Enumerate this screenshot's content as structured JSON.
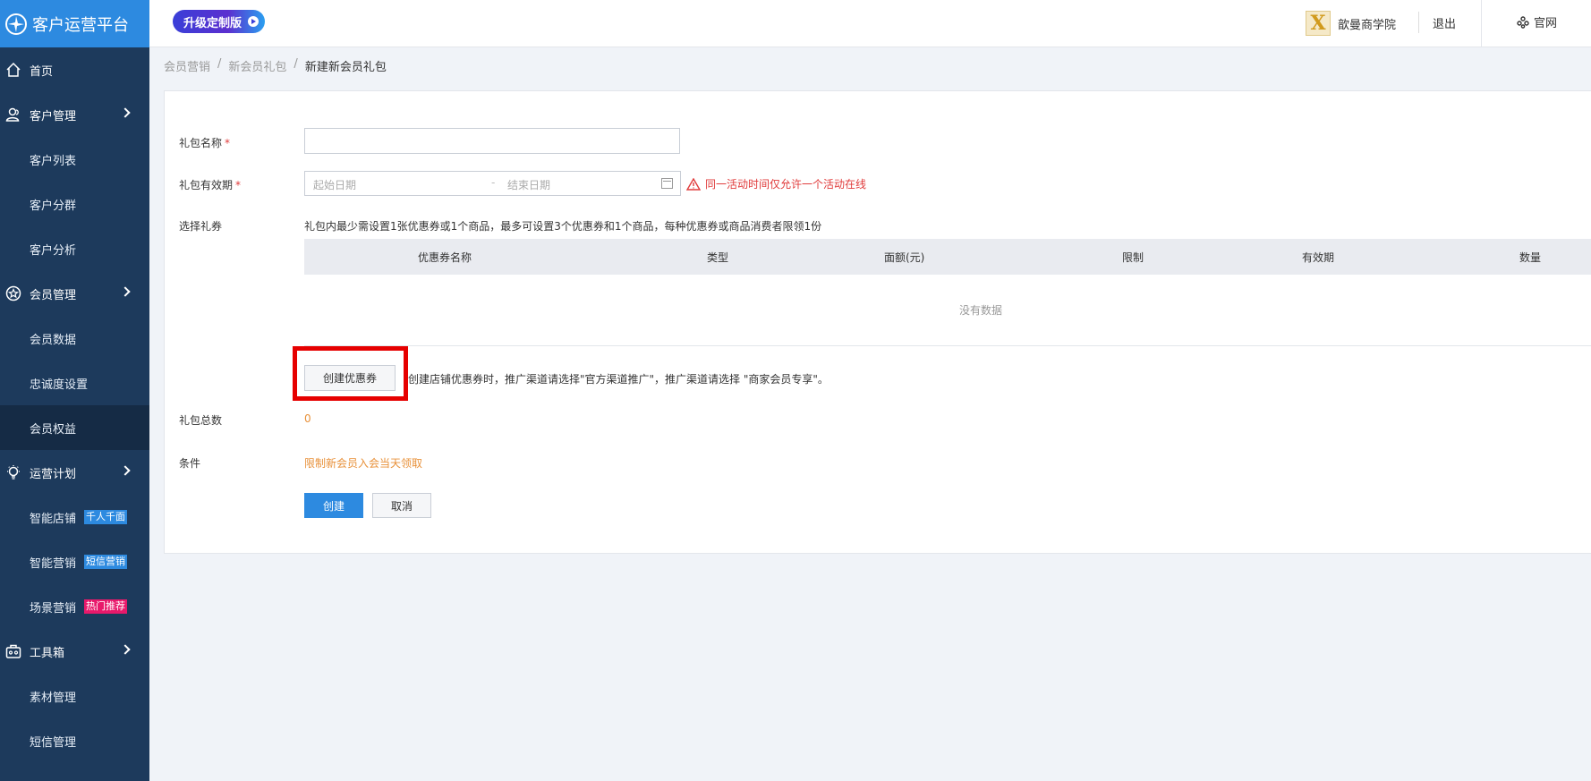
{
  "header": {
    "app_title": "客户运营平台",
    "upgrade_label": "升级定制版",
    "school_logo_letter": "X",
    "school_name": "歆曼商学院",
    "logout_label": "退出",
    "official_label": "官网"
  },
  "sidebar": {
    "items": [
      {
        "label": "首页",
        "icon": "home-icon"
      },
      {
        "label": "客户管理",
        "icon": "user-group-icon"
      },
      {
        "label": "客户列表"
      },
      {
        "label": "客户分群"
      },
      {
        "label": "客户分析"
      },
      {
        "label": "会员管理",
        "icon": "star-badge-icon"
      },
      {
        "label": "会员数据"
      },
      {
        "label": "忠诚度设置"
      },
      {
        "label": "会员权益"
      },
      {
        "label": "运营计划",
        "icon": "bulb-icon"
      },
      {
        "label": "智能店铺",
        "badge": "千人千面"
      },
      {
        "label": "智能营销",
        "badge": "短信营销"
      },
      {
        "label": "场景营销",
        "badge": "热门推荐"
      },
      {
        "label": "工具箱",
        "icon": "toolbox-icon"
      },
      {
        "label": "素材管理"
      },
      {
        "label": "短信管理"
      }
    ]
  },
  "breadcrumb": {
    "items": [
      "会员营销",
      "新会员礼包",
      "新建新会员礼包"
    ],
    "sep": "/"
  },
  "form": {
    "name_label": "礼包名称",
    "validity_label": "礼包有效期",
    "required_mark": "*",
    "start_placeholder": "起始日期",
    "range_sep": "-",
    "end_placeholder": "结束日期",
    "validity_warning": "同一活动时间仅允许一个活动在线",
    "coupon_label": "选择礼券",
    "coupon_hint": "礼包内最少需设置1张优惠券或1个商品，最多可设置3个优惠券和1个商品，每种优惠券或商品消费者限领1份",
    "columns": [
      "优惠券名称",
      "类型",
      "面额(元)",
      "限制",
      "有效期",
      "数量"
    ],
    "empty_text": "没有数据",
    "create_coupon_label": "创建优惠券",
    "create_coupon_note": "创建店铺优惠券时，推广渠道请选择\"官方渠道推广\"，推广渠道请选择 \"商家会员专享\"。",
    "total_label": "礼包总数",
    "total_value": "0",
    "condition_label": "条件",
    "condition_value": "限制新会员入会当天领取",
    "submit_label": "创建",
    "cancel_label": "取消"
  },
  "colors": {
    "sidebar_bg": "#1d3a5c",
    "primary": "#2d8ae0",
    "warning": "#e03b3b",
    "accent_orange": "#e8913a",
    "highlight": "#e60000"
  }
}
